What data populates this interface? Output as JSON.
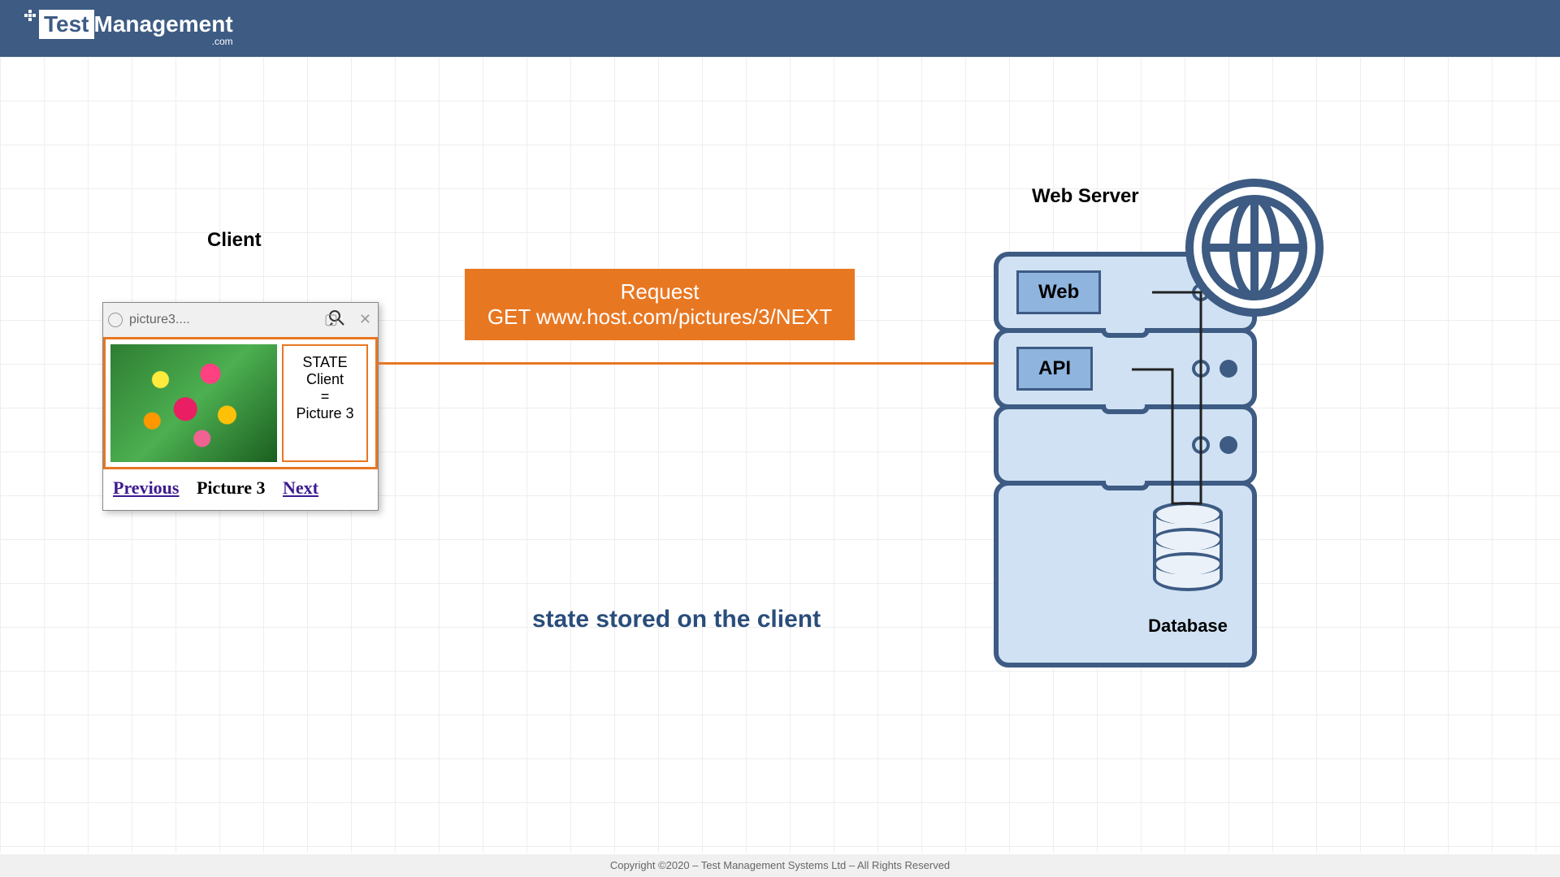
{
  "header": {
    "logo_test": "Test",
    "logo_mgmt": "Management",
    "logo_com": ".com"
  },
  "client": {
    "label": "Client",
    "browser_title": "picture3....",
    "state_box": {
      "line1": "STATE",
      "line2": "Client",
      "line3": "=",
      "line4": "Picture 3"
    },
    "nav": {
      "prev": "Previous",
      "current": "Picture 3",
      "next": "Next"
    }
  },
  "request": {
    "line1": "Request",
    "line2": "GET www.host.com/pictures/3/NEXT"
  },
  "caption": "state stored on the client",
  "server": {
    "label": "Web Server",
    "web_tag": "Web",
    "api_tag": "API",
    "db_label": "Database"
  },
  "footer": "Copyright ©2020 – Test Management Systems Ltd – All Rights Reserved"
}
